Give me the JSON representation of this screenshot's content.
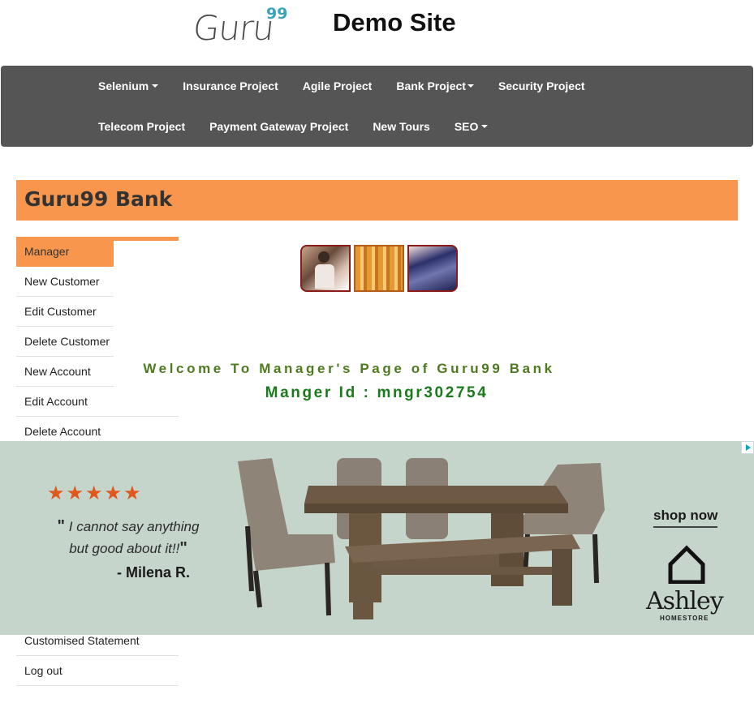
{
  "header": {
    "logo_text": "Guru",
    "logo_sup": "99",
    "site_title": "Demo Site"
  },
  "nav": {
    "row1": [
      {
        "label": "Selenium",
        "dropdown": true
      },
      {
        "label": "Insurance Project",
        "dropdown": false
      },
      {
        "label": "Agile Project",
        "dropdown": false
      },
      {
        "label": "Bank Project",
        "dropdown": true
      },
      {
        "label": "Security Project",
        "dropdown": false
      }
    ],
    "row2": [
      {
        "label": "Telecom Project",
        "dropdown": false
      },
      {
        "label": "Payment Gateway Project",
        "dropdown": false
      },
      {
        "label": "New Tours",
        "dropdown": false
      },
      {
        "label": "SEO",
        "dropdown": true
      }
    ]
  },
  "bank": {
    "title": "Guru99 Bank"
  },
  "sidebar": {
    "items": [
      {
        "label": "Manager",
        "active": true
      },
      {
        "label": "New Customer"
      },
      {
        "label": "Edit Customer"
      },
      {
        "label": "Delete Customer"
      },
      {
        "label": "New Account"
      },
      {
        "label": "Edit Account"
      },
      {
        "label": "Delete Account"
      }
    ],
    "bottom_items": [
      {
        "label": "Customised Statement"
      },
      {
        "label": "Log out"
      }
    ]
  },
  "main": {
    "welcome": "Welcome To Manager's Page of Guru99 Bank",
    "manager_id": "Manger Id : mngr302754"
  },
  "ad": {
    "stars": "★★★★★",
    "quote": "I cannot say anything but good about it!!",
    "author": "- Milena R.",
    "cta": "shop now",
    "brand": "Ashley",
    "brand_sub": "HOMESTORE"
  },
  "colors": {
    "accent": "#f7964c",
    "navbar": "#555555",
    "welcome_green": "#4e7a1f",
    "id_green": "#1b7a1b"
  }
}
